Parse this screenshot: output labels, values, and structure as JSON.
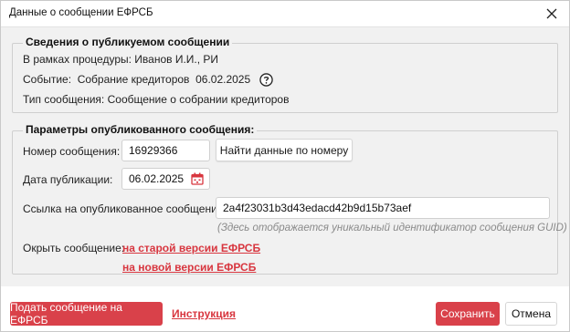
{
  "window": {
    "title": "Данные о сообщении ЕФРСБ"
  },
  "published_info": {
    "legend": "Сведения о публикуемом сообщении",
    "procedure_label": "В рамках процедуры:",
    "procedure_value": "Иванов И.И., РИ",
    "event_label": "Событие:",
    "event_value": "Собрание кредиторов",
    "event_date": "06.02.2025",
    "type_label": "Тип сообщения:",
    "type_value": "Сообщение о собрании кредиторов"
  },
  "published_params": {
    "legend": "Параметры опубликованного сообщения:",
    "number_label": "Номер сообщения:",
    "number_value": "16929366",
    "find_button": "Найти данные по номеру",
    "date_label": "Дата публикации:",
    "date_value": "06.02.2025",
    "link_label": "Ссылка на опубликованное сообщение:",
    "link_value": "2a4f23031b3d43edacd42b9d15b73aef",
    "link_hint": "(Здесь отображается уникальный идентификатор сообщения GUID)",
    "open_label": "Окрыть сообщение:",
    "open_old": "на старой версии ЕФРСБ",
    "open_new": "на новой версии ЕФРСБ"
  },
  "footer": {
    "submit_button": "Подать сообщение на ЕФРСБ",
    "instruction_link": "Инструкция",
    "save_button": "Сохранить",
    "cancel_button": "Отмена"
  },
  "colors": {
    "accent": "#d9414a",
    "link": "#d8363f",
    "panel": "#f1f1f1"
  },
  "icons": [
    "close-icon",
    "help-icon",
    "calendar-icon"
  ]
}
